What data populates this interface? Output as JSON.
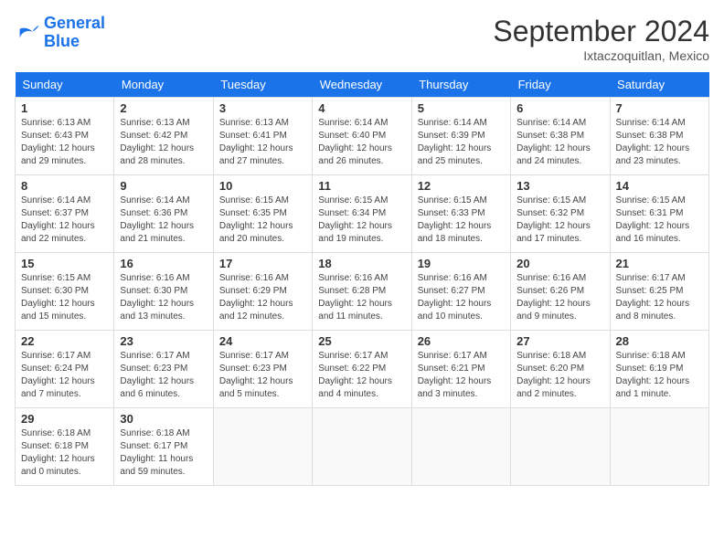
{
  "logo": {
    "line1": "General",
    "line2": "Blue"
  },
  "title": "September 2024",
  "location": "Ixtaczoquitlan, Mexico",
  "weekdays": [
    "Sunday",
    "Monday",
    "Tuesday",
    "Wednesday",
    "Thursday",
    "Friday",
    "Saturday"
  ],
  "weeks": [
    [
      {
        "day": "1",
        "sunrise": "6:13 AM",
        "sunset": "6:43 PM",
        "daylight": "12 hours and 29 minutes."
      },
      {
        "day": "2",
        "sunrise": "6:13 AM",
        "sunset": "6:42 PM",
        "daylight": "12 hours and 28 minutes."
      },
      {
        "day": "3",
        "sunrise": "6:13 AM",
        "sunset": "6:41 PM",
        "daylight": "12 hours and 27 minutes."
      },
      {
        "day": "4",
        "sunrise": "6:14 AM",
        "sunset": "6:40 PM",
        "daylight": "12 hours and 26 minutes."
      },
      {
        "day": "5",
        "sunrise": "6:14 AM",
        "sunset": "6:39 PM",
        "daylight": "12 hours and 25 minutes."
      },
      {
        "day": "6",
        "sunrise": "6:14 AM",
        "sunset": "6:38 PM",
        "daylight": "12 hours and 24 minutes."
      },
      {
        "day": "7",
        "sunrise": "6:14 AM",
        "sunset": "6:38 PM",
        "daylight": "12 hours and 23 minutes."
      }
    ],
    [
      {
        "day": "8",
        "sunrise": "6:14 AM",
        "sunset": "6:37 PM",
        "daylight": "12 hours and 22 minutes."
      },
      {
        "day": "9",
        "sunrise": "6:14 AM",
        "sunset": "6:36 PM",
        "daylight": "12 hours and 21 minutes."
      },
      {
        "day": "10",
        "sunrise": "6:15 AM",
        "sunset": "6:35 PM",
        "daylight": "12 hours and 20 minutes."
      },
      {
        "day": "11",
        "sunrise": "6:15 AM",
        "sunset": "6:34 PM",
        "daylight": "12 hours and 19 minutes."
      },
      {
        "day": "12",
        "sunrise": "6:15 AM",
        "sunset": "6:33 PM",
        "daylight": "12 hours and 18 minutes."
      },
      {
        "day": "13",
        "sunrise": "6:15 AM",
        "sunset": "6:32 PM",
        "daylight": "12 hours and 17 minutes."
      },
      {
        "day": "14",
        "sunrise": "6:15 AM",
        "sunset": "6:31 PM",
        "daylight": "12 hours and 16 minutes."
      }
    ],
    [
      {
        "day": "15",
        "sunrise": "6:15 AM",
        "sunset": "6:30 PM",
        "daylight": "12 hours and 15 minutes."
      },
      {
        "day": "16",
        "sunrise": "6:16 AM",
        "sunset": "6:30 PM",
        "daylight": "12 hours and 13 minutes."
      },
      {
        "day": "17",
        "sunrise": "6:16 AM",
        "sunset": "6:29 PM",
        "daylight": "12 hours and 12 minutes."
      },
      {
        "day": "18",
        "sunrise": "6:16 AM",
        "sunset": "6:28 PM",
        "daylight": "12 hours and 11 minutes."
      },
      {
        "day": "19",
        "sunrise": "6:16 AM",
        "sunset": "6:27 PM",
        "daylight": "12 hours and 10 minutes."
      },
      {
        "day": "20",
        "sunrise": "6:16 AM",
        "sunset": "6:26 PM",
        "daylight": "12 hours and 9 minutes."
      },
      {
        "day": "21",
        "sunrise": "6:17 AM",
        "sunset": "6:25 PM",
        "daylight": "12 hours and 8 minutes."
      }
    ],
    [
      {
        "day": "22",
        "sunrise": "6:17 AM",
        "sunset": "6:24 PM",
        "daylight": "12 hours and 7 minutes."
      },
      {
        "day": "23",
        "sunrise": "6:17 AM",
        "sunset": "6:23 PM",
        "daylight": "12 hours and 6 minutes."
      },
      {
        "day": "24",
        "sunrise": "6:17 AM",
        "sunset": "6:23 PM",
        "daylight": "12 hours and 5 minutes."
      },
      {
        "day": "25",
        "sunrise": "6:17 AM",
        "sunset": "6:22 PM",
        "daylight": "12 hours and 4 minutes."
      },
      {
        "day": "26",
        "sunrise": "6:17 AM",
        "sunset": "6:21 PM",
        "daylight": "12 hours and 3 minutes."
      },
      {
        "day": "27",
        "sunrise": "6:18 AM",
        "sunset": "6:20 PM",
        "daylight": "12 hours and 2 minutes."
      },
      {
        "day": "28",
        "sunrise": "6:18 AM",
        "sunset": "6:19 PM",
        "daylight": "12 hours and 1 minute."
      }
    ],
    [
      {
        "day": "29",
        "sunrise": "6:18 AM",
        "sunset": "6:18 PM",
        "daylight": "12 hours and 0 minutes."
      },
      {
        "day": "30",
        "sunrise": "6:18 AM",
        "sunset": "6:17 PM",
        "daylight": "11 hours and 59 minutes."
      },
      null,
      null,
      null,
      null,
      null
    ]
  ]
}
